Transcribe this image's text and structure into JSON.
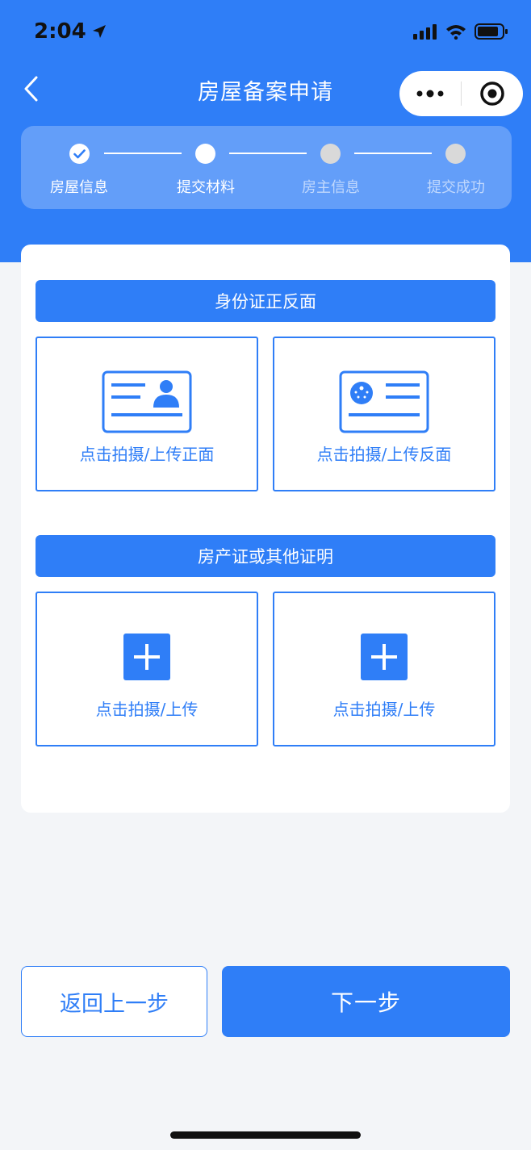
{
  "status_bar": {
    "time": "2:04"
  },
  "nav": {
    "title": "房屋备案申请"
  },
  "steps": [
    {
      "label": "房屋信息",
      "state": "done"
    },
    {
      "label": "提交材料",
      "state": "active"
    },
    {
      "label": "房主信息",
      "state": "pending"
    },
    {
      "label": "提交成功",
      "state": "pending"
    }
  ],
  "sections": {
    "id_card": {
      "title": "身份证正反面",
      "front_label": "点击拍摄/上传正面",
      "back_label": "点击拍摄/上传反面"
    },
    "property": {
      "title": "房产证或其他证明",
      "upload1_label": "点击拍摄/上传",
      "upload2_label": "点击拍摄/上传"
    }
  },
  "buttons": {
    "back": "返回上一步",
    "next": "下一步"
  },
  "colors": {
    "primary": "#2f7ef7",
    "background": "#f3f5f8"
  }
}
